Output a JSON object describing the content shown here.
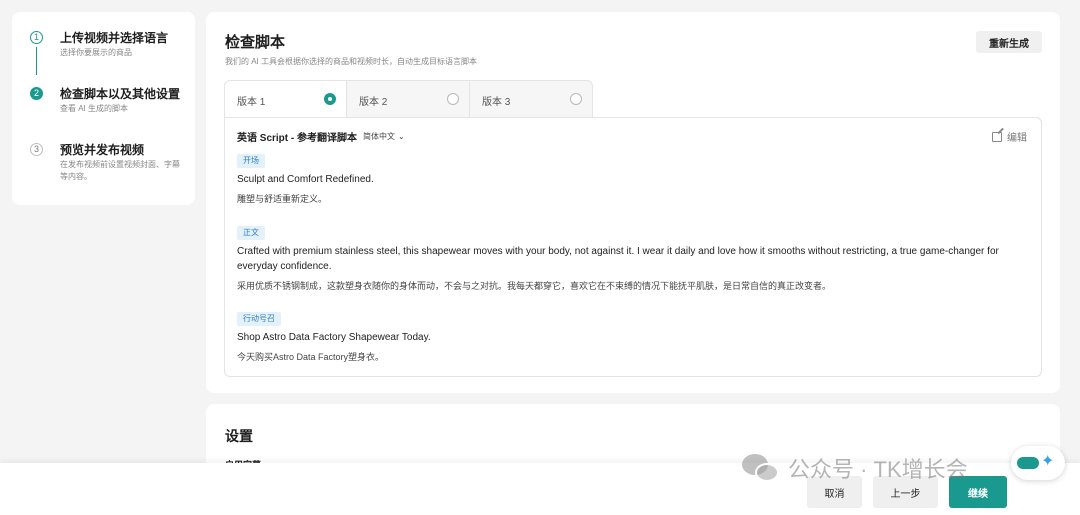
{
  "stepper": {
    "steps": [
      {
        "num": "1",
        "title": "上传视频并选择语言",
        "desc": "选择你要展示的商品"
      },
      {
        "num": "2",
        "title": "检查脚本以及其他设置",
        "desc": "查看 AI 生成的脚本"
      },
      {
        "num": "3",
        "title": "预览并发布视频",
        "desc": "在发布视频前设置视频封面、字幕等内容。"
      }
    ]
  },
  "main": {
    "title": "检查脚本",
    "subtitle": "我们的 AI 工具会根据你选择的商品和视频时长，自动生成目标语言脚本",
    "regen_label": "重新生成",
    "tabs": [
      {
        "label": "版本 1",
        "selected": true
      },
      {
        "label": "版本 2",
        "selected": false
      },
      {
        "label": "版本 3",
        "selected": false
      }
    ],
    "script": {
      "heading": "英语 Script - 参考翻译脚本",
      "lang_select": "简体中文",
      "edit_label": "编辑",
      "sections": [
        {
          "tag": "开场",
          "en": "Sculpt and Comfort Redefined.",
          "zh": "雕塑与舒适重新定义。"
        },
        {
          "tag": "正文",
          "en": "Crafted with premium stainless steel, this shapewear moves with your body, not against it. I wear it daily and love how it smooths without restricting, a true game-changer for everyday confidence.",
          "zh": "采用优质不锈钢制成，这款塑身衣随你的身体而动，不会与之对抗。我每天都穿它，喜欢它在不束缚的情况下能抚平肌肤，是日常自信的真正改变者。"
        },
        {
          "tag": "行动号召",
          "en": "Shop Astro Data Factory Shapewear Today.",
          "zh": "今天购买Astro Data Factory塑身衣。"
        }
      ]
    }
  },
  "settings": {
    "title": "设置",
    "subtitle_label": "启用字幕"
  },
  "footer": {
    "cancel": "取消",
    "prev": "上一步",
    "next": "继续"
  },
  "watermark": {
    "text": "公众号 · TK增长会"
  },
  "colors": {
    "accent": "#1a9a8e",
    "tag_text": "#2c7fc4",
    "tag_bg": "#e3f1fb"
  }
}
